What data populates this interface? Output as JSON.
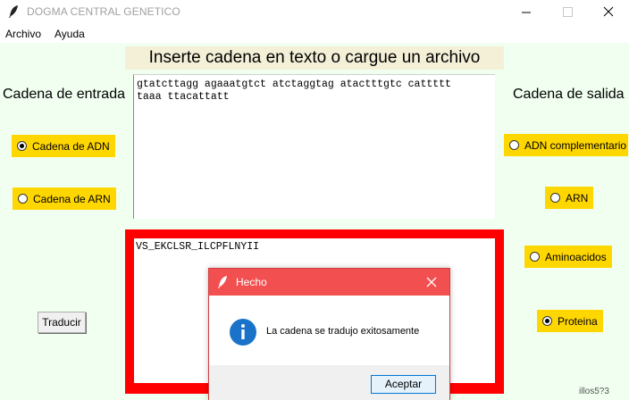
{
  "window": {
    "title": "DOGMA CENTRAL GENETICO"
  },
  "menu": {
    "items": [
      "Archivo",
      "Ayuda"
    ]
  },
  "header": {
    "label": "Inserte cadena en texto o cargue un archivo"
  },
  "left": {
    "title": "Cadena de entrada",
    "options": [
      {
        "label": "Cadena de ADN",
        "selected": true
      },
      {
        "label": "Cadena de ARN",
        "selected": false
      }
    ]
  },
  "right": {
    "title": "Cadena de salida",
    "options": [
      {
        "label": "ADN complementario",
        "selected": false
      },
      {
        "label": "ARN",
        "selected": false
      },
      {
        "label": "Aminoacidos",
        "selected": false
      },
      {
        "label": "Proteina",
        "selected": true
      }
    ]
  },
  "input": {
    "value": "gtatcttagg agaaatgtct atctaggtag atactttgtc cattttt\ntaaa ttacattatt"
  },
  "output": {
    "value": "VS_EKCLSR_ILCPFLNYII"
  },
  "translate_button": {
    "label": "Traducir"
  },
  "partial": {
    "text": "illos5?3"
  },
  "dialog": {
    "title": "Hecho",
    "message": "La cadena se tradujo exitosamente",
    "ok_label": "Aceptar"
  },
  "colors": {
    "accent_red": "#ff0000",
    "radio_bg": "#ffd700",
    "bg": "#f0fff0"
  },
  "icons": [
    "feather-icon",
    "minimize-icon",
    "maximize-icon",
    "close-icon",
    "info-icon"
  ]
}
